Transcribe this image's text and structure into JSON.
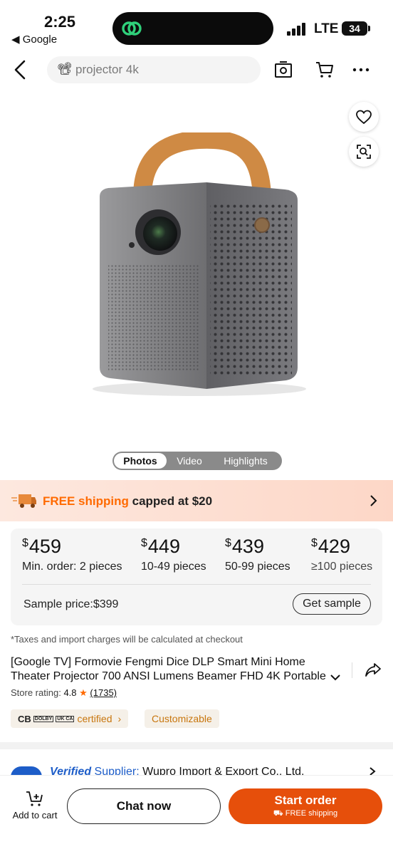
{
  "status_bar": {
    "time": "2:25",
    "back_app": "◀ Google",
    "network": "LTE",
    "battery": "34"
  },
  "nav": {
    "search_emoji": "📽",
    "search_text": "projector 4k"
  },
  "media_tabs": [
    "Photos",
    "Video",
    "Highlights"
  ],
  "shipping": {
    "highlight": "FREE shipping",
    "rest": " capped at $20"
  },
  "price_tiers": [
    {
      "currency": "$",
      "amount": "459",
      "qty": "Min. order: 2 pieces"
    },
    {
      "currency": "$",
      "amount": "449",
      "qty": "10-49 pieces"
    },
    {
      "currency": "$",
      "amount": "439",
      "qty": "50-99 pieces"
    },
    {
      "currency": "$",
      "amount": "429",
      "qty": "≥100 pieces"
    }
  ],
  "sample": {
    "price": "Sample price:$399",
    "button": "Get sample"
  },
  "tax_note": "*Taxes and import charges will be calculated at checkout",
  "product_title": "[Google TV] Formovie Fengmi Dice DLP Smart Mini Home Theater Projector 700 ANSI Lumens Beamer FHD 4K Portable",
  "rating": {
    "label": "Store rating: ",
    "value": "4.8",
    "star": "★",
    "count": "(1735)"
  },
  "badges": {
    "cert_logos": [
      "CB",
      "DOLBY",
      "UK CA"
    ],
    "certified": "certified",
    "chevron": "›",
    "customizable": "Customizable"
  },
  "supplier": {
    "verified": "Verified",
    "label": " Supplier:",
    "name": " Wupro Import & Export Co., Ltd."
  },
  "bottom": {
    "add_to_cart": "Add to cart",
    "chat": "Chat now",
    "start_order": "Start order",
    "free_shipping": "FREE shipping"
  },
  "colors": {
    "accent": "#ff6a00",
    "order_button": "#e64f0b",
    "supplier_blue": "#1d5dc8",
    "badge_text": "#c8760e"
  }
}
